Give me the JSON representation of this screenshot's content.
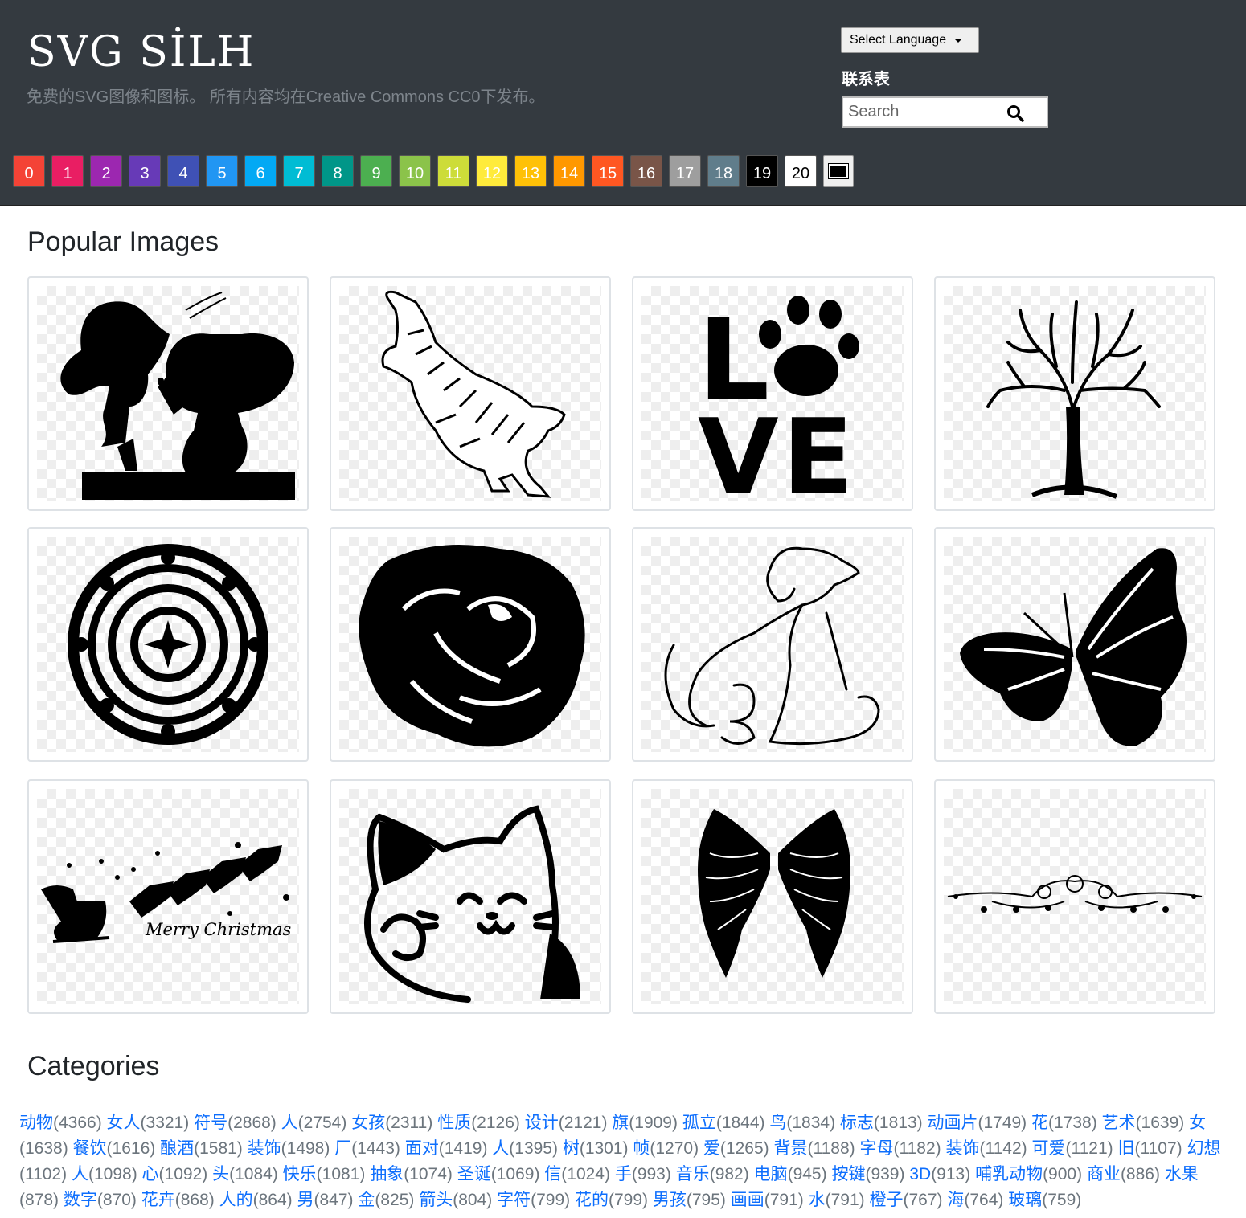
{
  "header": {
    "brand": "SVG SİLH",
    "tagline": "免费的SVG图像和图标。 所有内容均在Creative Commons CC0下发布。",
    "language_label": "Select Language",
    "contact_label": "联系表",
    "search_placeholder": "Search"
  },
  "swatches": [
    {
      "label": "0",
      "color": "#f44336"
    },
    {
      "label": "1",
      "color": "#e91e63"
    },
    {
      "label": "2",
      "color": "#9c27b0"
    },
    {
      "label": "3",
      "color": "#673ab7"
    },
    {
      "label": "4",
      "color": "#3f51b5"
    },
    {
      "label": "5",
      "color": "#2196f3"
    },
    {
      "label": "6",
      "color": "#03a9f4"
    },
    {
      "label": "7",
      "color": "#00bcd4"
    },
    {
      "label": "8",
      "color": "#009688"
    },
    {
      "label": "9",
      "color": "#4caf50"
    },
    {
      "label": "10",
      "color": "#8bc34a"
    },
    {
      "label": "11",
      "color": "#cddc39"
    },
    {
      "label": "12",
      "color": "#ffeb3b"
    },
    {
      "label": "13",
      "color": "#ffc107"
    },
    {
      "label": "14",
      "color": "#ff9800"
    },
    {
      "label": "15",
      "color": "#ff5722"
    },
    {
      "label": "16",
      "color": "#795548"
    },
    {
      "label": "17",
      "color": "#9e9e9e"
    },
    {
      "label": "18",
      "color": "#607d8b"
    },
    {
      "label": "19",
      "color": "#000000"
    },
    {
      "label": "20",
      "color": "#ffffff"
    }
  ],
  "popular": {
    "heading": "Popular Images",
    "images": [
      {
        "subject": "couple-silhouette"
      },
      {
        "subject": "tiger"
      },
      {
        "subject": "love-paw"
      },
      {
        "subject": "bare-tree"
      },
      {
        "subject": "mandala"
      },
      {
        "subject": "rose"
      },
      {
        "subject": "dog-line-art"
      },
      {
        "subject": "butterfly"
      },
      {
        "subject": "santa-sleigh"
      },
      {
        "subject": "lucky-cat"
      },
      {
        "subject": "angel-wings"
      },
      {
        "subject": "floral-divider"
      }
    ],
    "merry_text": "Merry Christmas",
    "love_letters": [
      "L",
      "V",
      "E"
    ]
  },
  "categories": {
    "heading": "Categories",
    "items": [
      {
        "name": "动物",
        "count": "(4366)"
      },
      {
        "name": "女人",
        "count": "(3321)"
      },
      {
        "name": "符号",
        "count": "(2868)"
      },
      {
        "name": "人",
        "count": "(2754)"
      },
      {
        "name": "女孩",
        "count": "(2311)"
      },
      {
        "name": "性质",
        "count": "(2126)"
      },
      {
        "name": "设计",
        "count": "(2121)"
      },
      {
        "name": "旗",
        "count": "(1909)"
      },
      {
        "name": "孤立",
        "count": "(1844)"
      },
      {
        "name": "鸟",
        "count": "(1834)"
      },
      {
        "name": "标志",
        "count": "(1813)"
      },
      {
        "name": "动画片",
        "count": "(1749)"
      },
      {
        "name": "花",
        "count": "(1738)"
      },
      {
        "name": "艺术",
        "count": "(1639)"
      },
      {
        "name": "女",
        "count": "(1638)"
      },
      {
        "name": "餐饮",
        "count": "(1616)"
      },
      {
        "name": "酿酒",
        "count": "(1581)"
      },
      {
        "name": "装饰",
        "count": "(1498)"
      },
      {
        "name": "厂",
        "count": "(1443)"
      },
      {
        "name": "面对",
        "count": "(1419)"
      },
      {
        "name": "人",
        "count": "(1395)"
      },
      {
        "name": "树",
        "count": "(1301)"
      },
      {
        "name": "帧",
        "count": "(1270)"
      },
      {
        "name": "爱",
        "count": "(1265)"
      },
      {
        "name": "背景",
        "count": "(1188)"
      },
      {
        "name": "字母",
        "count": "(1182)"
      },
      {
        "name": "装饰",
        "count": "(1142)"
      },
      {
        "name": "可爱",
        "count": "(1121)"
      },
      {
        "name": "旧",
        "count": "(1107)"
      },
      {
        "name": "幻想",
        "count": "(1102)"
      },
      {
        "name": "人",
        "count": "(1098)"
      },
      {
        "name": "心",
        "count": "(1092)"
      },
      {
        "name": "头",
        "count": "(1084)"
      },
      {
        "name": "快乐",
        "count": "(1081)"
      },
      {
        "name": "抽象",
        "count": "(1074)"
      },
      {
        "name": "圣诞",
        "count": "(1069)"
      },
      {
        "name": "信",
        "count": "(1024)"
      },
      {
        "name": "手",
        "count": "(993)"
      },
      {
        "name": "音乐",
        "count": "(982)"
      },
      {
        "name": "电脑",
        "count": "(945)"
      },
      {
        "name": "按键",
        "count": "(939)"
      },
      {
        "name": "3D",
        "count": "(913)"
      },
      {
        "name": "哺乳动物",
        "count": "(900)"
      },
      {
        "name": "商业",
        "count": "(886)"
      },
      {
        "name": "水果",
        "count": "(878)"
      },
      {
        "name": "数字",
        "count": "(870)"
      },
      {
        "name": "花卉",
        "count": "(868)"
      },
      {
        "name": "人的",
        "count": "(864)"
      },
      {
        "name": "男",
        "count": "(847)"
      },
      {
        "name": "金",
        "count": "(825)"
      },
      {
        "name": "箭头",
        "count": "(804)"
      },
      {
        "name": "字符",
        "count": "(799)"
      },
      {
        "name": "花的",
        "count": "(799)"
      },
      {
        "name": "男孩",
        "count": "(795)"
      },
      {
        "name": "画画",
        "count": "(791)"
      },
      {
        "name": "水",
        "count": "(791)"
      },
      {
        "name": "橙子",
        "count": "(767)"
      },
      {
        "name": "海",
        "count": "(764)"
      },
      {
        "name": "玻璃",
        "count": "(759)"
      }
    ]
  }
}
